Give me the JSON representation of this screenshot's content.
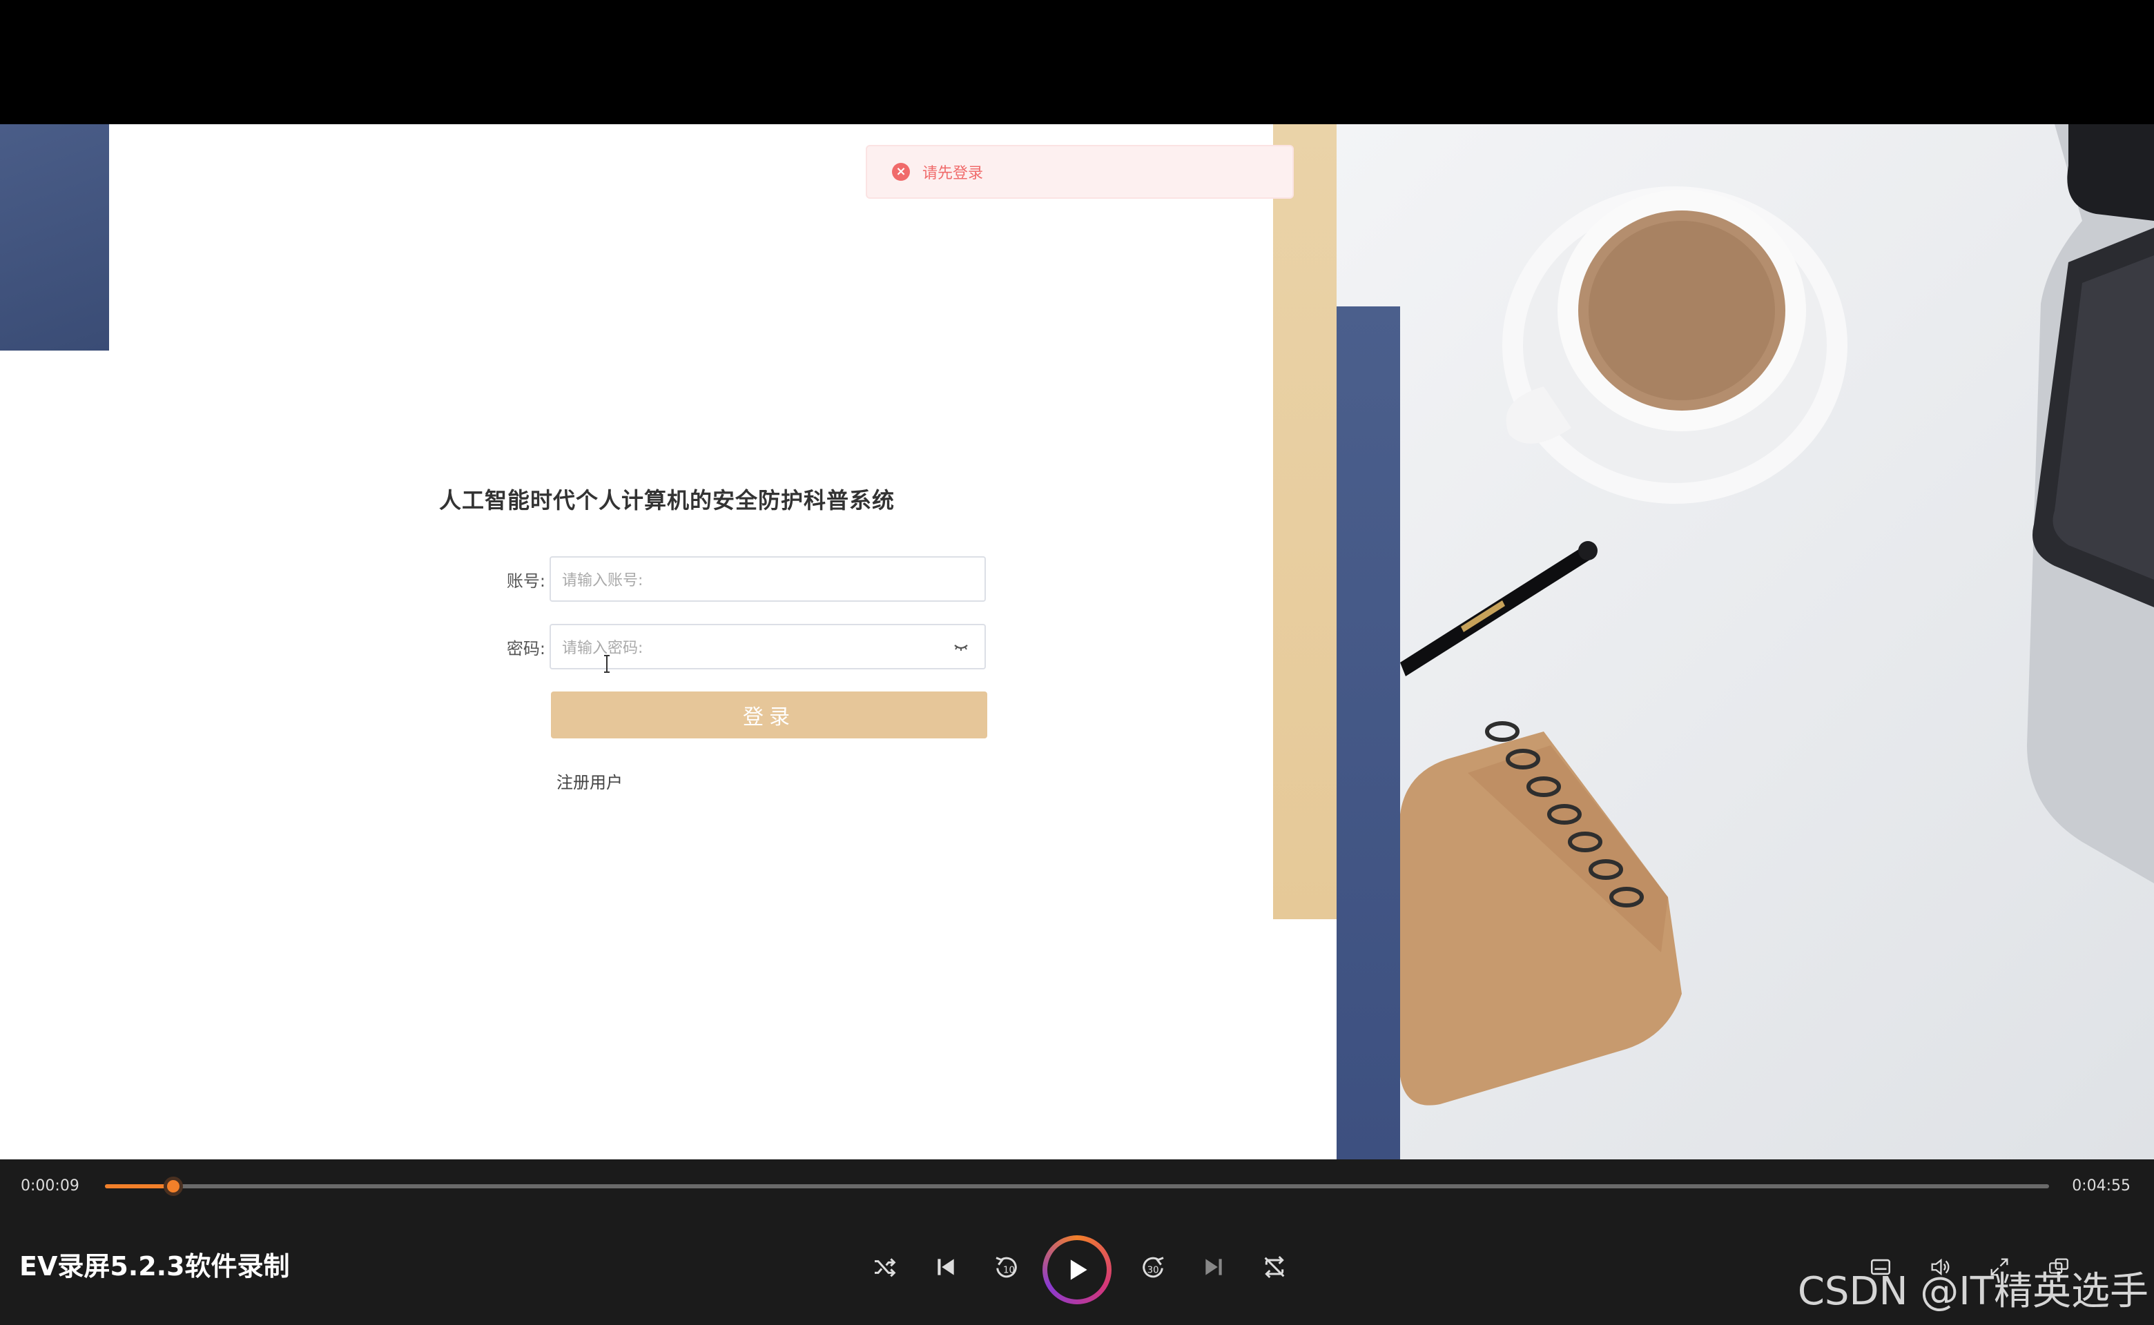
{
  "toast": {
    "message": "请先登录",
    "icon": "close-circle-icon",
    "color": "#f06b6b"
  },
  "login": {
    "title": "人工智能时代个人计算机的安全防护科普系统",
    "account_label": "账号:",
    "account_placeholder": "请输入账号:",
    "password_label": "密码:",
    "password_placeholder": "请输入密码:",
    "login_button": "登录",
    "register_link": "注册用户",
    "button_color": "#e6c699"
  },
  "player": {
    "current_time": "0:00:09",
    "total_time": "0:04:55",
    "progress": 0.035,
    "video_title": "EV录屏5.2.3软件录制",
    "accent_color": "#f2802a",
    "controls": [
      "shuffle-icon",
      "previous-icon",
      "rewind-10-icon",
      "play-icon",
      "forward-30-icon",
      "next-icon",
      "repeat-off-icon"
    ],
    "right_controls": [
      "subtitles-icon",
      "volume-icon",
      "fullscreen-icon",
      "mini-player-icon"
    ]
  },
  "watermark": "CSDN @IT精英选手"
}
